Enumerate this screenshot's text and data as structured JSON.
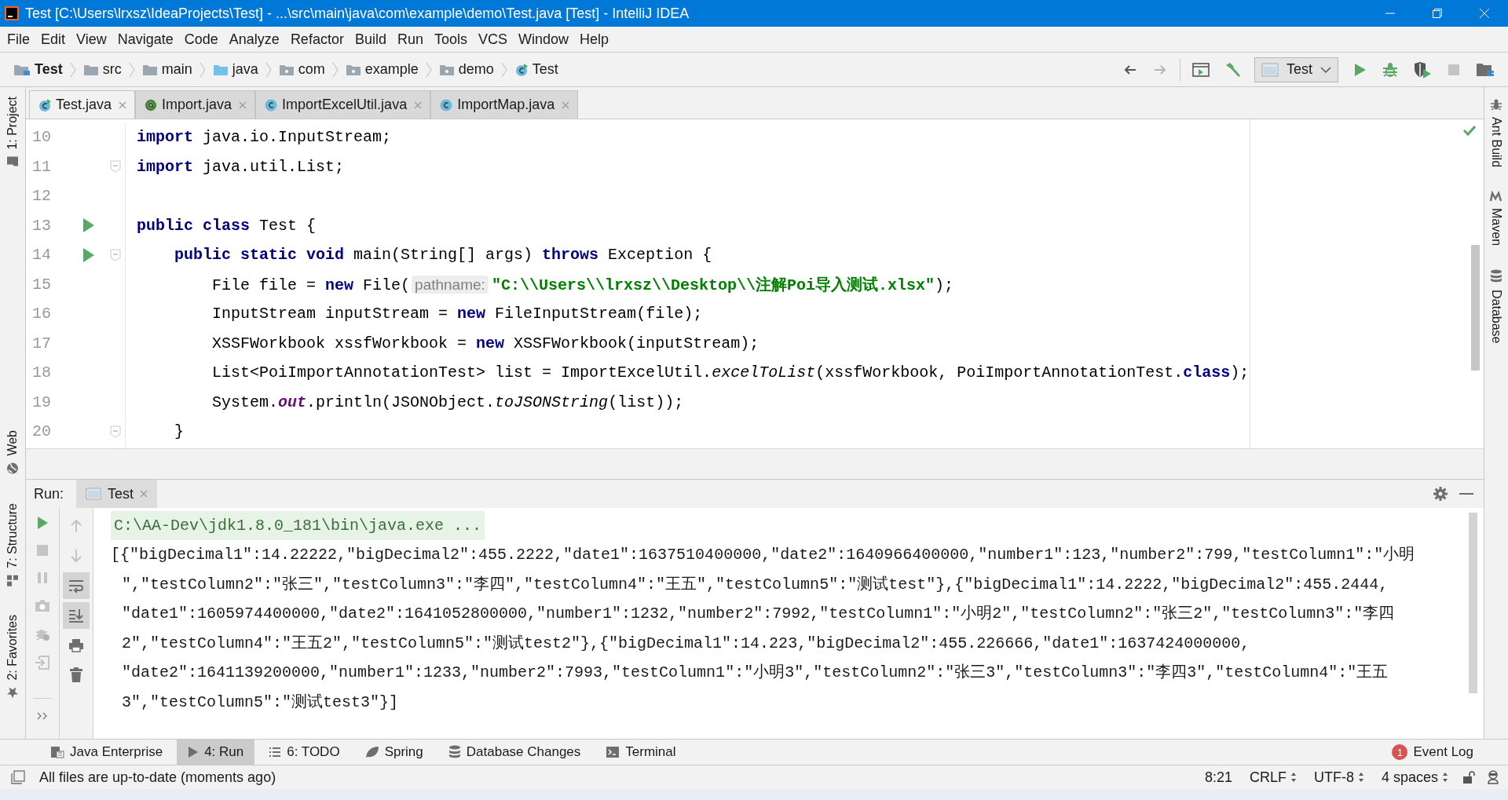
{
  "window": {
    "title": "Test [C:\\Users\\lrxsz\\IdeaProjects\\Test] - ...\\src\\main\\java\\com\\example\\demo\\Test.java [Test] - IntelliJ IDEA"
  },
  "menu": [
    "File",
    "Edit",
    "View",
    "Navigate",
    "Code",
    "Analyze",
    "Refactor",
    "Build",
    "Run",
    "Tools",
    "VCS",
    "Window",
    "Help"
  ],
  "breadcrumbs": [
    {
      "label": "Test",
      "kind": "project"
    },
    {
      "label": "src",
      "kind": "folder"
    },
    {
      "label": "main",
      "kind": "folder"
    },
    {
      "label": "java",
      "kind": "source"
    },
    {
      "label": "com",
      "kind": "package"
    },
    {
      "label": "example",
      "kind": "package"
    },
    {
      "label": "demo",
      "kind": "package"
    },
    {
      "label": "Test",
      "kind": "class"
    }
  ],
  "toolbar": {
    "run_config": "Test",
    "forward_disabled": true,
    "stop_disabled": true
  },
  "left_tools": [
    {
      "label": "1: Project",
      "kind": "folder"
    },
    {
      "label": "Web",
      "kind": "globe"
    },
    {
      "label": "7: Structure",
      "kind": "structure"
    },
    {
      "label": "2: Favorites",
      "kind": "star"
    }
  ],
  "right_tools": [
    {
      "label": "Ant Build",
      "kind": "ant"
    },
    {
      "label": "Maven",
      "kind": "maven"
    },
    {
      "label": "Database",
      "kind": "database"
    }
  ],
  "editor_tabs": [
    {
      "label": "Test.java",
      "kind": "class",
      "selected": true
    },
    {
      "label": "Import.java",
      "kind": "annotation",
      "selected": false
    },
    {
      "label": "ImportExcelUtil.java",
      "kind": "class",
      "selected": false
    },
    {
      "label": "ImportMap.java",
      "kind": "class",
      "selected": false
    }
  ],
  "editor": {
    "lines": [
      {
        "number": "10",
        "run": false,
        "fold": false,
        "tokens": [
          {
            "kind": "kw",
            "text": "import"
          },
          {
            "kind": "text",
            "text": " java.io.InputStream;"
          }
        ]
      },
      {
        "number": "11",
        "run": false,
        "fold": true,
        "tokens": [
          {
            "kind": "kw",
            "text": "import"
          },
          {
            "kind": "text",
            "text": " java.util.List;"
          }
        ]
      },
      {
        "number": "12",
        "run": false,
        "fold": false
      },
      {
        "number": "13",
        "run": true,
        "fold": false,
        "tokens": [
          {
            "kind": "kw",
            "text": "public class"
          },
          {
            "kind": "text",
            "text": " Test {"
          }
        ]
      },
      {
        "number": "14",
        "run": true,
        "fold": true,
        "tokens": [
          {
            "kind": "kw",
            "text": "    public static void"
          },
          {
            "kind": "text",
            "text": " main(String[] args) "
          },
          {
            "kind": "kw",
            "text": "throws"
          },
          {
            "kind": "text",
            "text": " Exception {"
          }
        ]
      },
      {
        "number": "15",
        "run": false,
        "fold": false,
        "tokens": [
          {
            "kind": "text",
            "text": "        File file = "
          },
          {
            "kind": "kw",
            "text": "new"
          },
          {
            "kind": "text",
            "text": " File("
          },
          {
            "kind": "hint",
            "text": "pathname:"
          },
          {
            "kind": "str",
            "text": "\"C:\\\\Users\\\\lrxsz\\\\Desktop\\\\注解Poi导入测试.xlsx\""
          },
          {
            "kind": "text",
            "text": ");"
          }
        ]
      },
      {
        "number": "16",
        "run": false,
        "fold": false,
        "tokens": [
          {
            "kind": "text",
            "text": "        InputStream inputStream = "
          },
          {
            "kind": "kw",
            "text": "new"
          },
          {
            "kind": "text",
            "text": " FileInputStream(file);"
          }
        ]
      },
      {
        "number": "17",
        "run": false,
        "fold": false,
        "tokens": [
          {
            "kind": "text",
            "text": "        XSSFWorkbook xssfWorkbook = "
          },
          {
            "kind": "kw",
            "text": "new"
          },
          {
            "kind": "text",
            "text": " XSSFWorkbook(inputStream);"
          }
        ]
      },
      {
        "number": "18",
        "run": false,
        "fold": false,
        "tokens": [
          {
            "kind": "text",
            "text": "        List<PoiImportAnnotationTest> list = ImportExcelUtil."
          },
          {
            "kind": "italic",
            "text": "excelToList"
          },
          {
            "kind": "text",
            "text": "(xssfWorkbook, PoiImportAnnotationTest."
          },
          {
            "kind": "kw",
            "text": "class"
          },
          {
            "kind": "text",
            "text": ");"
          }
        ]
      },
      {
        "number": "19",
        "run": false,
        "fold": false,
        "tokens": [
          {
            "kind": "text",
            "text": "        System."
          },
          {
            "kind": "field",
            "text": "out"
          },
          {
            "kind": "text",
            "text": ".println(JSONObject."
          },
          {
            "kind": "italic",
            "text": "toJSONString"
          },
          {
            "kind": "text",
            "text": "(list));"
          }
        ]
      },
      {
        "number": "20",
        "run": false,
        "fold": true,
        "tokens": [
          {
            "kind": "text",
            "text": "    }"
          }
        ]
      }
    ]
  },
  "run": {
    "label": "Run:",
    "tab": "Test",
    "command": "C:\\AA-Dev\\jdk1.8.0_181\\bin\\java.exe ...",
    "output": [
      "[{\"bigDecimal1\":14.22222,\"bigDecimal2\":455.2222,\"date1\":1637510400000,\"date2\":1640966400000,\"number1\":123,\"number2\":799,\"testColumn1\":\"小明",
      "\",\"testColumn2\":\"张三\",\"testColumn3\":\"李四\",\"testColumn4\":\"王五\",\"testColumn5\":\"测试test\"},{\"bigDecimal1\":14.2222,\"bigDecimal2\":455.2444,",
      "\"date1\":1605974400000,\"date2\":1641052800000,\"number1\":1232,\"number2\":7992,\"testColumn1\":\"小明2\",\"testColumn2\":\"张三2\",\"testColumn3\":\"李四",
      "2\",\"testColumn4\":\"王五2\",\"testColumn5\":\"测试test2\"},{\"bigDecimal1\":14.223,\"bigDecimal2\":455.226666,\"date1\":1637424000000,",
      "\"date2\":1641139200000,\"number1\":1233,\"number2\":7993,\"testColumn1\":\"小明3\",\"testColumn2\":\"张三3\",\"testColumn3\":\"李四3\",\"testColumn4\":\"王五",
      "3\",\"testColumn5\":\"测试test3\"}]"
    ]
  },
  "run_actions": [
    {
      "kind": "up",
      "on": false
    },
    {
      "kind": "down",
      "on": false
    },
    {
      "kind": "wrap",
      "on": true
    },
    {
      "kind": "scroll",
      "on": true
    },
    {
      "kind": "print",
      "on": false
    },
    {
      "kind": "clear",
      "on": false
    }
  ],
  "tool_tabs": [
    {
      "label": "Java Enterprise",
      "kind": "enterprise",
      "selected": false
    },
    {
      "label": "4: Run",
      "kind": "run",
      "selected": true
    },
    {
      "label": "6: TODO",
      "kind": "todo",
      "selected": false
    },
    {
      "label": "Spring",
      "kind": "spring",
      "selected": false
    },
    {
      "label": "Database Changes",
      "kind": "dbchanges",
      "selected": false
    },
    {
      "label": "Terminal",
      "kind": "terminal",
      "selected": false
    }
  ],
  "event_log": {
    "label": "Event Log",
    "count": "1"
  },
  "status_bar": {
    "message": "All files are up-to-date (moments ago)",
    "position": "8:21",
    "line_separator": "CRLF",
    "encoding": "UTF-8",
    "indent": "4 spaces"
  }
}
